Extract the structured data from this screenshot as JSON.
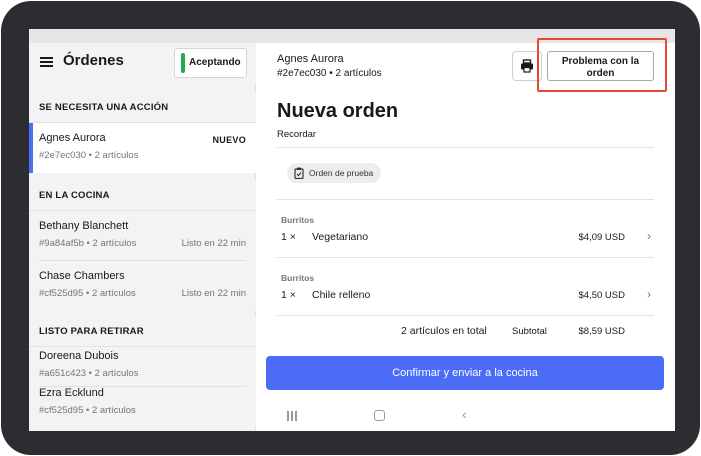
{
  "sidebar": {
    "title": "Órdenes",
    "status_toggle": "Aceptando",
    "sections": [
      {
        "label": "SE NECESITA UNA ACCIÓN"
      },
      {
        "label": "EN LA COCINA"
      },
      {
        "label": "LISTO PARA RETIRAR"
      }
    ],
    "orders": [
      {
        "name": "Agnes Aurora",
        "meta": "#2e7ec030 • 2 artículos",
        "badge": "NUEVO"
      },
      {
        "name": "Bethany Blanchett",
        "meta": "#9a84af5b • 2 artículos",
        "status": "Listo en 22 min"
      },
      {
        "name": "Chase Chambers",
        "meta": "#cf525d95 • 2 artículos",
        "status": "Listo en 22 min"
      },
      {
        "name": "Doreena Dubois",
        "meta": "#a651c423 • 2 artículos"
      },
      {
        "name": "Ezra Ecklund",
        "meta": "#cf525d95 • 2 artículos"
      }
    ]
  },
  "detail": {
    "customer_name": "Agnes Aurora",
    "customer_meta": "#2e7ec030 • 2 artículos",
    "problem_button": "Problema con la orden",
    "title": "Nueva orden",
    "remember": "Recordar",
    "test_tag": "Orden de prueba",
    "items": [
      {
        "category": "Burritos",
        "qty": "1 ×",
        "name": "Vegetariano",
        "price": "$4,09 USD"
      },
      {
        "category": "Burritos",
        "qty": "1 ×",
        "name": "Chile relleno",
        "price": "$4,50 USD"
      }
    ],
    "total_count": "2 artículos en total",
    "subtotal_label": "Subtotal",
    "subtotal_value": "$8,59 USD",
    "confirm_button": "Confirmar y enviar a la cocina"
  },
  "colors": {
    "accent": "#4b6cf7",
    "accepting_indicator": "#1faa4b",
    "annotation": "#e24a33"
  }
}
